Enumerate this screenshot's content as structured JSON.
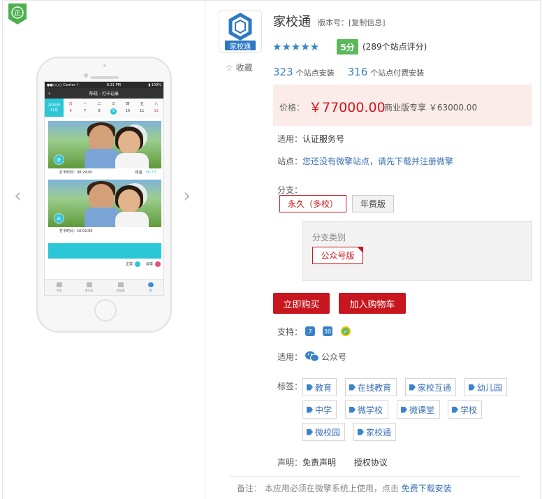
{
  "badge": {
    "text": "正"
  },
  "phone_screen": {
    "status_left": "●●○○○ Carrier ⇡",
    "status_time": "8:21 PM",
    "status_right": "▮ 100%",
    "title": "陈晓 - 打卡记录",
    "month_year": "2016年",
    "month": "11月",
    "weekdays": [
      "日",
      "一",
      "二",
      "三",
      "四",
      "五",
      "六"
    ],
    "dates": [
      "6",
      "7",
      "8",
      "9",
      "10",
      "11",
      "12"
    ],
    "record1": {
      "tag": "进",
      "time": "打卡时间：08:29:00",
      "temp_label": "体温：",
      "temp_value": "36.7℃"
    },
    "record2": {
      "tag": "出",
      "time": "打卡时间：16:02:00"
    },
    "legend_normal": "正常",
    "legend_abnormal": "异常",
    "tabs": [
      "学校",
      "通讯录",
      "班级圈",
      "我"
    ]
  },
  "app": {
    "icon_text": "家校通",
    "name": "家校通",
    "version_label": "版本号：",
    "copy_info": "[复制信息]",
    "stars": "★★★★★",
    "score": "5分",
    "rating_text": "(289个站点评分)",
    "favorite": "收藏",
    "favorite_icon": "☆",
    "installs_count": "323",
    "installs_label": "个站点安装",
    "paid_count": "316",
    "paid_label": "个站点付费安装"
  },
  "price": {
    "label": "价格：",
    "value": "￥77000.00",
    "business": "商业版专享 ￥63000.00"
  },
  "applies": {
    "label": "适用：",
    "value": "认证服务号"
  },
  "site": {
    "label": "站点：",
    "link": "您还没有微擎站点，请先下载并注册微擎"
  },
  "branch": {
    "label": "分支：",
    "options": [
      "永久（多校）",
      "年费版"
    ],
    "selected": "永久（多校）",
    "sub_label": "分支类别",
    "sub_option": "公众号版"
  },
  "buttons": {
    "buy": "立即购买",
    "cart": "加入购物车"
  },
  "support": {
    "label": "支持：",
    "icons": [
      "7",
      "30",
      "✓"
    ]
  },
  "applies2": {
    "label": "适用：",
    "value": "公众号"
  },
  "tags": {
    "label": "标签：",
    "items": [
      "教育",
      "在线教育",
      "家校互通",
      "幼儿园",
      "中学",
      "微学校",
      "微课堂",
      "学校",
      "微校园",
      "家校通"
    ]
  },
  "statement": {
    "label": "声明：",
    "disclaimer": "免责声明",
    "license": "授权协议"
  },
  "footer": {
    "note": "备注： 本应用必须在微擎系统上使用，点击 ",
    "link": "免费下载安装"
  },
  "colors": {
    "accent": "#c7161e",
    "link": "#3a6fb5",
    "score_bg": "#5cb85c",
    "star": "#3a83c8"
  }
}
